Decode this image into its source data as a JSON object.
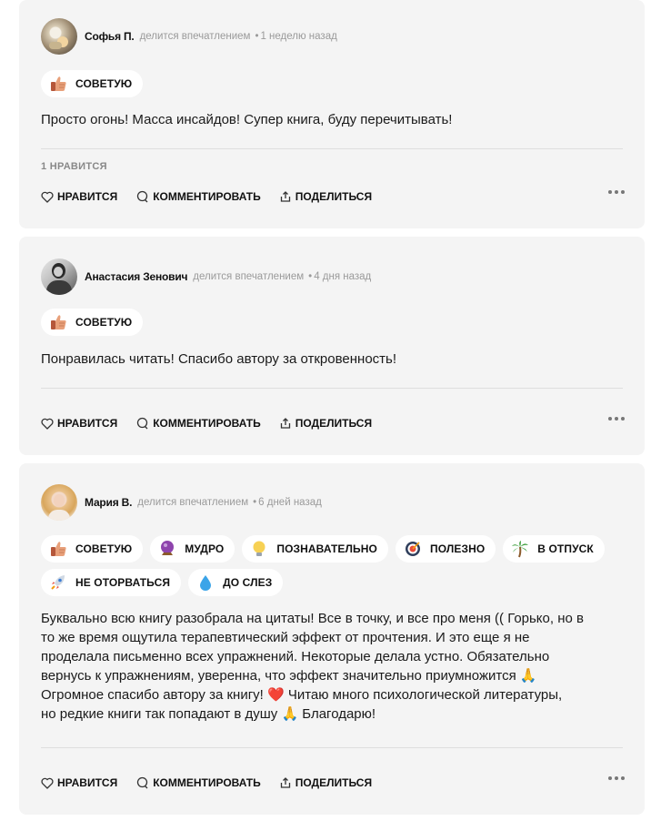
{
  "reviews": [
    {
      "author": "Софья П.",
      "action": "делится впечатлением",
      "separator": "•",
      "time": "1 неделю назад",
      "tags": [
        {
          "label": "СОВЕТУЮ",
          "icon": "thumbs-up-icon"
        }
      ],
      "text": "Просто огонь! Масса инсайдов! Супер книга, буду перечитывать!",
      "likes_count": "1 НРАВИТСЯ"
    },
    {
      "author": "Анастасия Зенович",
      "action": "делится впечатлением",
      "separator": "•",
      "time": "4 дня назад",
      "tags": [
        {
          "label": "СОВЕТУЮ",
          "icon": "thumbs-up-icon"
        }
      ],
      "text": "Понравилась читать! Спасибо автору за откровенность!"
    },
    {
      "author": "Мария В.",
      "action": "делится впечатлением",
      "separator": "•",
      "time": "6 дней назад",
      "tags": [
        {
          "label": "СОВЕТУЮ",
          "icon": "thumbs-up-icon"
        },
        {
          "label": "МУДРО",
          "icon": "crystal-ball-icon"
        },
        {
          "label": "ПОЗНАВАТЕЛЬНО",
          "icon": "light-bulb-icon"
        },
        {
          "label": "ПОЛЕЗНО",
          "icon": "target-icon"
        },
        {
          "label": "В ОТПУСК",
          "icon": "palm-tree-icon"
        },
        {
          "label": "НЕ ОТОРВАТЬСЯ",
          "icon": "rocket-icon"
        },
        {
          "label": "ДО СЛЕЗ",
          "icon": "droplet-icon"
        }
      ],
      "text_lines": [
        "Буквально всю книгу разобрала на цитаты! Все в точку, и все про меня (( Горько, но в",
        "то же время ощутила терапевтический эффект от прочтения. И это еще я не",
        "проделала письменно всех упражнений. Некоторые делала устно. Обязательно",
        "вернусь к упражнениям, уверенна, что эффект значительно приумножится 🙏",
        "Огромное спасибо автору за книгу! ❤️  Читаю много психологической литературы,",
        "но редкие книги так попадают в душу 🙏 Благодарю!"
      ]
    }
  ],
  "actions": {
    "like": "НРАВИТСЯ",
    "comment": "КОММЕНТИРОВАТЬ",
    "share": "ПОДЕЛИТЬСЯ"
  },
  "colors": {
    "card_bg": "#f4f4f4",
    "tag_bg": "#ffffff",
    "meta_text": "#9a9a9a"
  }
}
